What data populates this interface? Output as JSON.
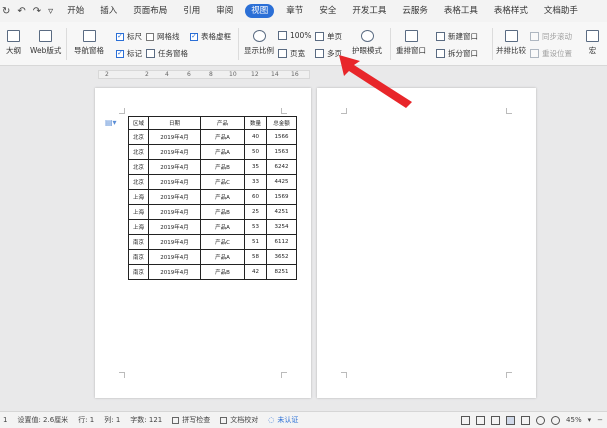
{
  "quick_access": [
    "↻",
    "↶",
    "↷",
    "▿"
  ],
  "tabs": [
    "开始",
    "插入",
    "页面布局",
    "引用",
    "审阅",
    "视图",
    "章节",
    "安全",
    "开发工具",
    "云服务",
    "表格工具",
    "表格样式",
    "文档助手"
  ],
  "ribbon": {
    "outline": "大纲",
    "web_layout": "Web版式",
    "nav_pane": "导航窗格",
    "ruler": "标尺",
    "gridlines": "网格线",
    "table_gridlines": "表格虚框",
    "marks": "标记",
    "task_pane": "任务窗格",
    "zoom": "显示比例",
    "zoom_100": "100%",
    "page_width": "页宽",
    "single_page": "单页",
    "multi_page": "多页",
    "eye_mode": "护眼模式",
    "rearrange": "重排窗口",
    "new_window": "新建窗口",
    "split_window": "拆分窗口",
    "side_by_side": "并排比较",
    "sync_scroll": "同步滚动",
    "reset_position": "重设位置",
    "more": "宏"
  },
  "ruler_labels": [
    "2",
    "2",
    "4",
    "6",
    "8",
    "10",
    "12",
    "14",
    "16"
  ],
  "table": {
    "headers": [
      "区域",
      "日期",
      "产品",
      "数量",
      "总金额"
    ],
    "rows": [
      [
        "北京",
        "2019年4月",
        "产品A",
        "40",
        "1566"
      ],
      [
        "北京",
        "2019年4月",
        "产品A",
        "50",
        "1563"
      ],
      [
        "北京",
        "2019年4月",
        "产品B",
        "35",
        "6242"
      ],
      [
        "北京",
        "2019年4月",
        "产品C",
        "33",
        "4425"
      ],
      [
        "上海",
        "2019年4月",
        "产品A",
        "60",
        "1569"
      ],
      [
        "上海",
        "2019年4月",
        "产品B",
        "25",
        "4251"
      ],
      [
        "上海",
        "2019年4月",
        "产品A",
        "53",
        "3254"
      ],
      [
        "南京",
        "2019年4月",
        "产品C",
        "51",
        "6112"
      ],
      [
        "南京",
        "2019年4月",
        "产品A",
        "58",
        "3652"
      ],
      [
        "南京",
        "2019年4月",
        "产品B",
        "42",
        "8251"
      ]
    ]
  },
  "status": {
    "page": "1",
    "setting": "设置值: 2.6厘米",
    "row": "行: 1",
    "col": "列: 1",
    "words": "字数: 121",
    "spellcheck": "拼写检查",
    "doc_check": "文档校对",
    "uncertified": "未认证",
    "zoom": "45%"
  },
  "colors": {
    "accent": "#2b6fd6",
    "arrow": "#e8262a"
  }
}
